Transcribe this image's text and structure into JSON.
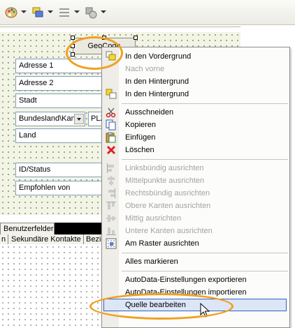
{
  "toolbar": {
    "icons": [
      "paint-palette-icon",
      "layer-order-icon",
      "align-lines-icon",
      "shape-tool-icon"
    ]
  },
  "form": {
    "geocode_label": "GeoCode",
    "fields": [
      "Adresse 1",
      "Adresse 2",
      "Stadt",
      "Bundesland\\Kan",
      "PLZ",
      "Land",
      "ID/Status",
      "Empfohlen von"
    ],
    "tabs": {
      "header": "Benutzerfelder",
      "items": [
        "n",
        "Sekundäre Kontakte",
        "Bezie"
      ]
    }
  },
  "menu": {
    "items": [
      {
        "label": "In den Vordergrund",
        "icon": "bring-to-front-icon",
        "enabled": true
      },
      {
        "label": "Nach vorne",
        "icon": "",
        "enabled": false
      },
      {
        "label": "In den Hintergrund",
        "icon": "",
        "enabled": true
      },
      {
        "label": "In den Hintergrund",
        "icon": "send-to-back-icon",
        "enabled": true
      },
      {
        "label": "Ausschneiden",
        "icon": "scissors-icon",
        "enabled": true
      },
      {
        "label": "Kopieren",
        "icon": "copy-icon",
        "enabled": true
      },
      {
        "label": "Einfügen",
        "icon": "paste-icon",
        "enabled": true
      },
      {
        "label": "Löschen",
        "icon": "delete-x-icon",
        "enabled": true
      },
      {
        "label": "Linksbündig ausrichten",
        "icon": "align-left-icon",
        "enabled": false
      },
      {
        "label": "Mittelpunkte ausrichten",
        "icon": "align-center-icon",
        "enabled": false
      },
      {
        "label": "Rechtsbündig ausrichten",
        "icon": "align-right-icon",
        "enabled": false
      },
      {
        "label": "Obere Kanten ausrichten",
        "icon": "align-top-icon",
        "enabled": false
      },
      {
        "label": "Mittig ausrichten",
        "icon": "align-middle-icon",
        "enabled": false
      },
      {
        "label": "Untere Kanten ausrichten",
        "icon": "align-bottom-icon",
        "enabled": false
      },
      {
        "label": "Am Raster ausrichten",
        "icon": "snap-to-grid-icon",
        "enabled": true
      },
      {
        "label": "Alles markieren",
        "icon": "",
        "enabled": true
      },
      {
        "label": "AutoData-Einstellungen exportieren",
        "icon": "",
        "enabled": true
      },
      {
        "label": "AutoData-Einstellungen importieren",
        "icon": "",
        "enabled": true
      },
      {
        "label": "Quelle bearbeiten",
        "icon": "",
        "enabled": true,
        "highlighted": true
      }
    ]
  },
  "colors": {
    "highlight_border": "#3161c2",
    "annotation_orange": "#f0a020",
    "canvas_bg": "#f2f4e4"
  }
}
